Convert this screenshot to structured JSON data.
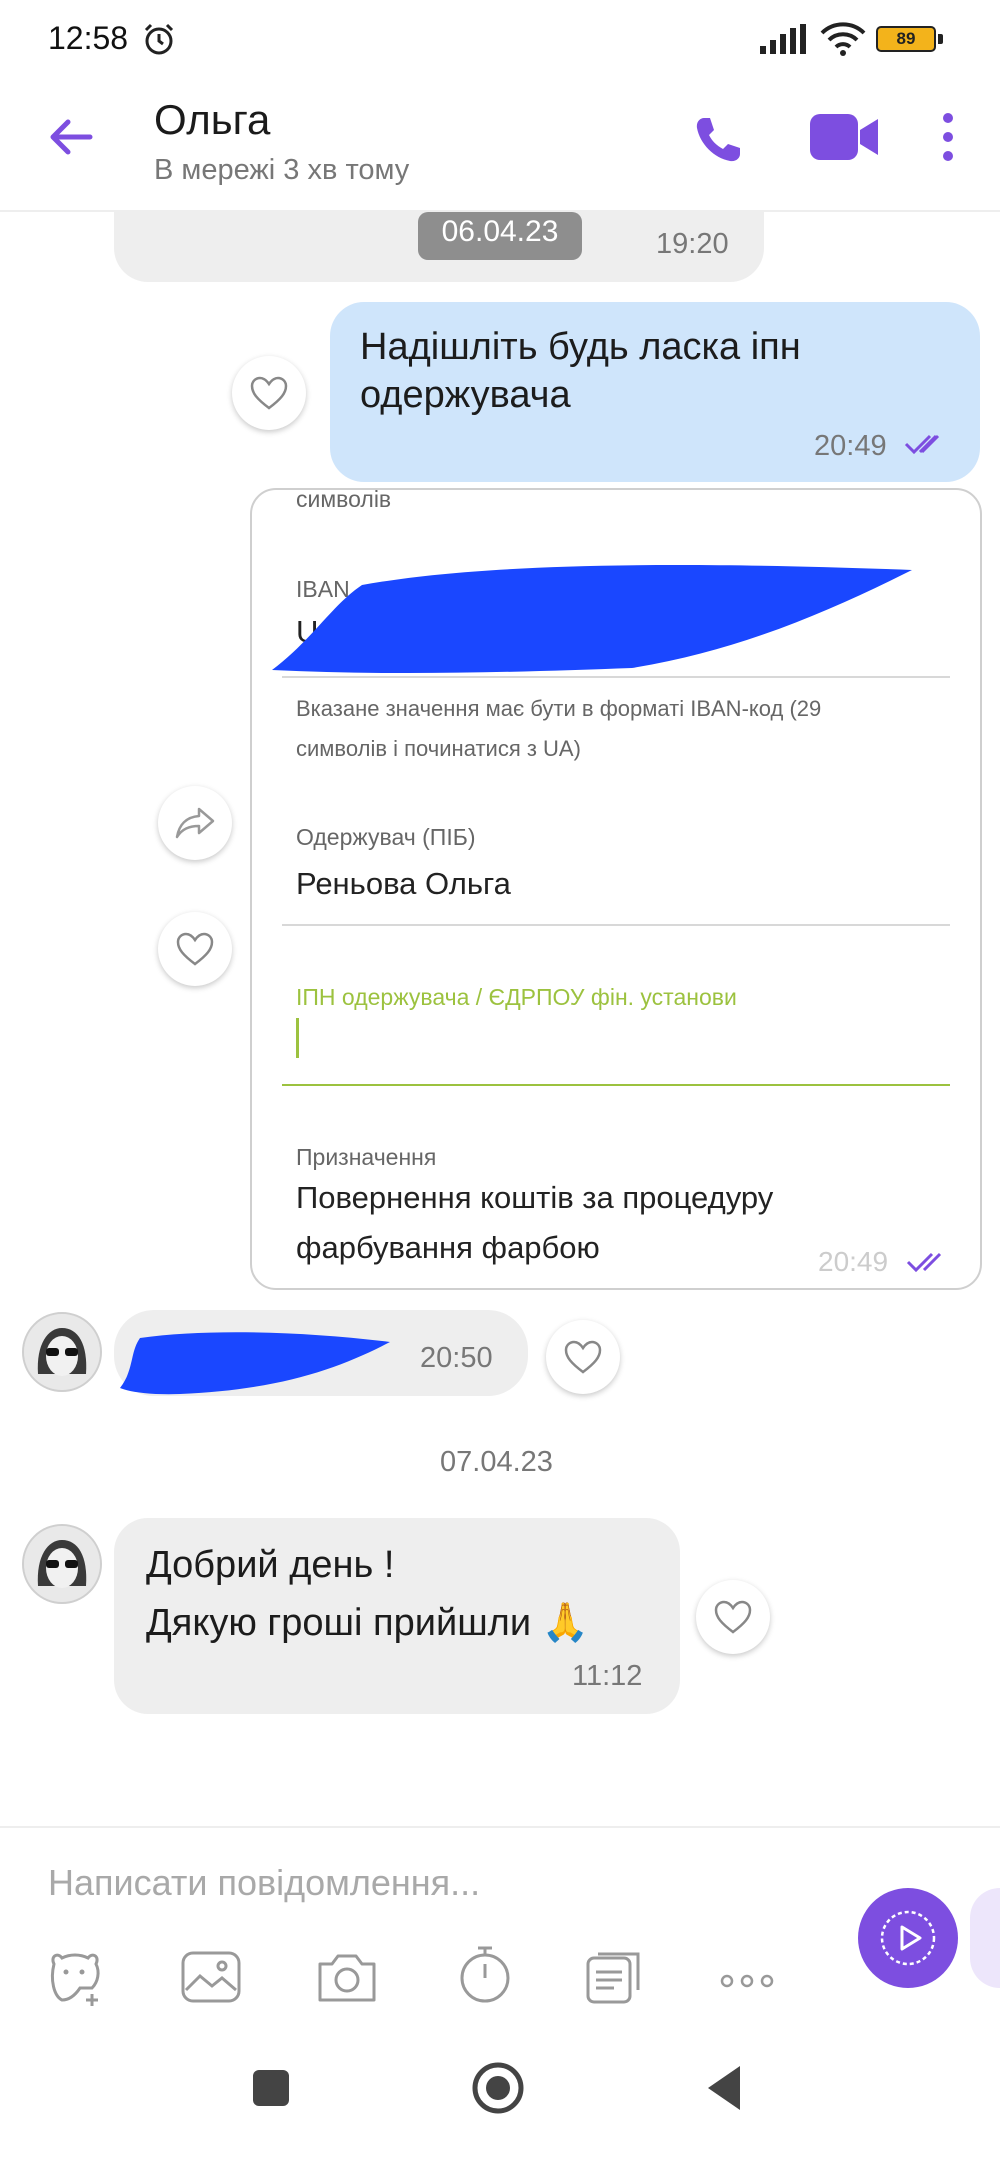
{
  "status_bar": {
    "time": "12:58",
    "battery": "89"
  },
  "header": {
    "name": "Ольга",
    "status": "В мережі 3 хв тому"
  },
  "messages": {
    "top_date_chip": "06.04.23",
    "top_time": "19:20",
    "outgoing_text_line1": "Надішліть будь ласка іпн",
    "outgoing_text_line2": "одержувача",
    "outgoing_time": "20:49",
    "form": {
      "cut_top": "символів",
      "iban_label": "IBAN",
      "iban_value": "U",
      "iban_help_line1": "Вказане значення має бути в форматі IBAN-код (29",
      "iban_help_line2": "символів і починатися з UA)",
      "recipient_label": "Одержувач (ПІБ)",
      "recipient_value": "Реньова Ольга",
      "ipn_label": "ІПН одержувача / ЄДРПОУ фін. установи",
      "purpose_label": "Призначення",
      "purpose_line1": "Повернення коштів за процедуру",
      "purpose_line2": "фарбування фарбою",
      "time": "20:49"
    },
    "incoming_link_time": "20:50",
    "date_separator": "07.04.23",
    "incoming_line1": "Добрий день !",
    "incoming_line2": "Дякую гроші прийшли 🙏",
    "incoming_time": "11:12"
  },
  "composer": {
    "placeholder": "Написати повідомлення..."
  },
  "colors": {
    "accent": "#7d4ee0",
    "outgoing_bubble": "#cfe5fb",
    "incoming_bubble": "#eeeeee",
    "ipn_green": "#9cc23f"
  }
}
